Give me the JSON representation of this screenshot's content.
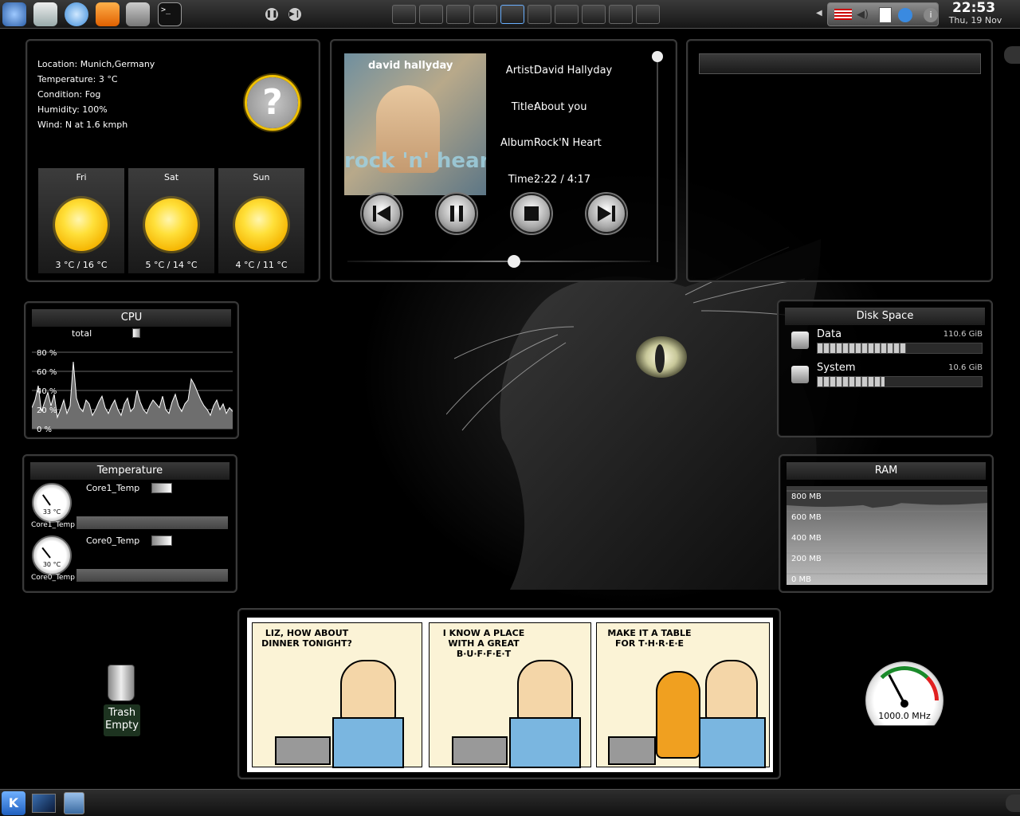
{
  "panel": {
    "clock_time": "22:53",
    "clock_date": "Thu, 19 Nov",
    "launchers": [
      "kde-menu-icon",
      "folder-network-icon",
      "help-icon",
      "rss-icon",
      "tools-icon",
      "terminal-icon"
    ],
    "media": [
      "pause-icon",
      "next-icon"
    ],
    "pager_count": 9
  },
  "weather": {
    "location_label": "Location:",
    "location": "Munich,Germany",
    "temperature_label": "Temperature:",
    "temperature": "3 °C",
    "condition_label": "Condition:",
    "condition": "Fog",
    "humidity_label": "Humidity:",
    "humidity": "100%",
    "wind_label": "Wind:",
    "wind": "N at 1.6 kmph",
    "icon_glyph": "?",
    "forecast": [
      {
        "day": "Fri",
        "range": "3 °C / 16 °C"
      },
      {
        "day": "Sat",
        "range": "5 °C / 14 °C"
      },
      {
        "day": "Sun",
        "range": "4 °C / 11 °C"
      }
    ]
  },
  "player": {
    "artist_label": "Artist:",
    "artist": "David Hallyday",
    "title_label": "Title:",
    "title": "About you",
    "album_label": "Album:",
    "album": "Rock'N Heart",
    "time_label": "Time:",
    "time": "2:22 / 4:17",
    "cover_top": "david hallyday",
    "cover_bottom": "rock 'n' heart",
    "progress": 0.55,
    "controls": [
      "previous-icon",
      "pause-icon",
      "stop-icon",
      "next-icon"
    ]
  },
  "cpu": {
    "title": "CPU",
    "legend": "total",
    "ticks": [
      "80 %",
      "60 %",
      "40 %",
      "20 %",
      "0 %"
    ],
    "history": [
      22,
      30,
      45,
      18,
      28,
      38,
      24,
      36,
      12,
      20,
      30,
      16,
      24,
      70,
      32,
      22,
      18,
      30,
      26,
      14,
      20,
      28,
      34,
      22,
      16,
      24,
      30,
      20,
      14,
      26,
      32,
      18,
      22,
      40,
      28,
      20,
      16,
      24,
      30,
      26,
      22,
      34,
      20,
      16,
      28,
      36,
      24,
      18,
      26,
      30,
      52,
      46,
      38,
      30,
      24,
      20,
      14,
      24,
      30,
      20,
      26,
      16,
      22,
      18
    ]
  },
  "temperature": {
    "title": "Temperature",
    "sensors": [
      {
        "name": "Core1_Temp",
        "value": "33 °C",
        "label": "Core1_Temp",
        "level": 0.33
      },
      {
        "name": "Core0_Temp",
        "value": "30 °C",
        "label": "Core0_Temp",
        "level": 0.3
      }
    ]
  },
  "disk": {
    "title": "Disk Space",
    "drives": [
      {
        "name": "Data",
        "size": "110.6 GiB",
        "used": 0.54
      },
      {
        "name": "System",
        "size": "10.6 GiB",
        "used": 0.41
      }
    ]
  },
  "ram": {
    "title": "RAM",
    "ticks": [
      "800 MB",
      "600 MB",
      "400 MB",
      "200 MB",
      "0 MB"
    ]
  },
  "comic": {
    "panel1": "LIZ, HOW ABOUT DINNER TONIGHT?",
    "panel2": "I KNOW A PLACE WITH A GREAT B·U·F·F·E·T",
    "panel3": "MAKE IT A TABLE FOR T·H·R·E·E"
  },
  "trash": {
    "line1": "Trash",
    "line2": "Empty"
  },
  "cpufreq": {
    "value": "1000.0 MHz"
  },
  "colors": {
    "accent": "#f5c400",
    "frame": "#3a3a3a"
  }
}
